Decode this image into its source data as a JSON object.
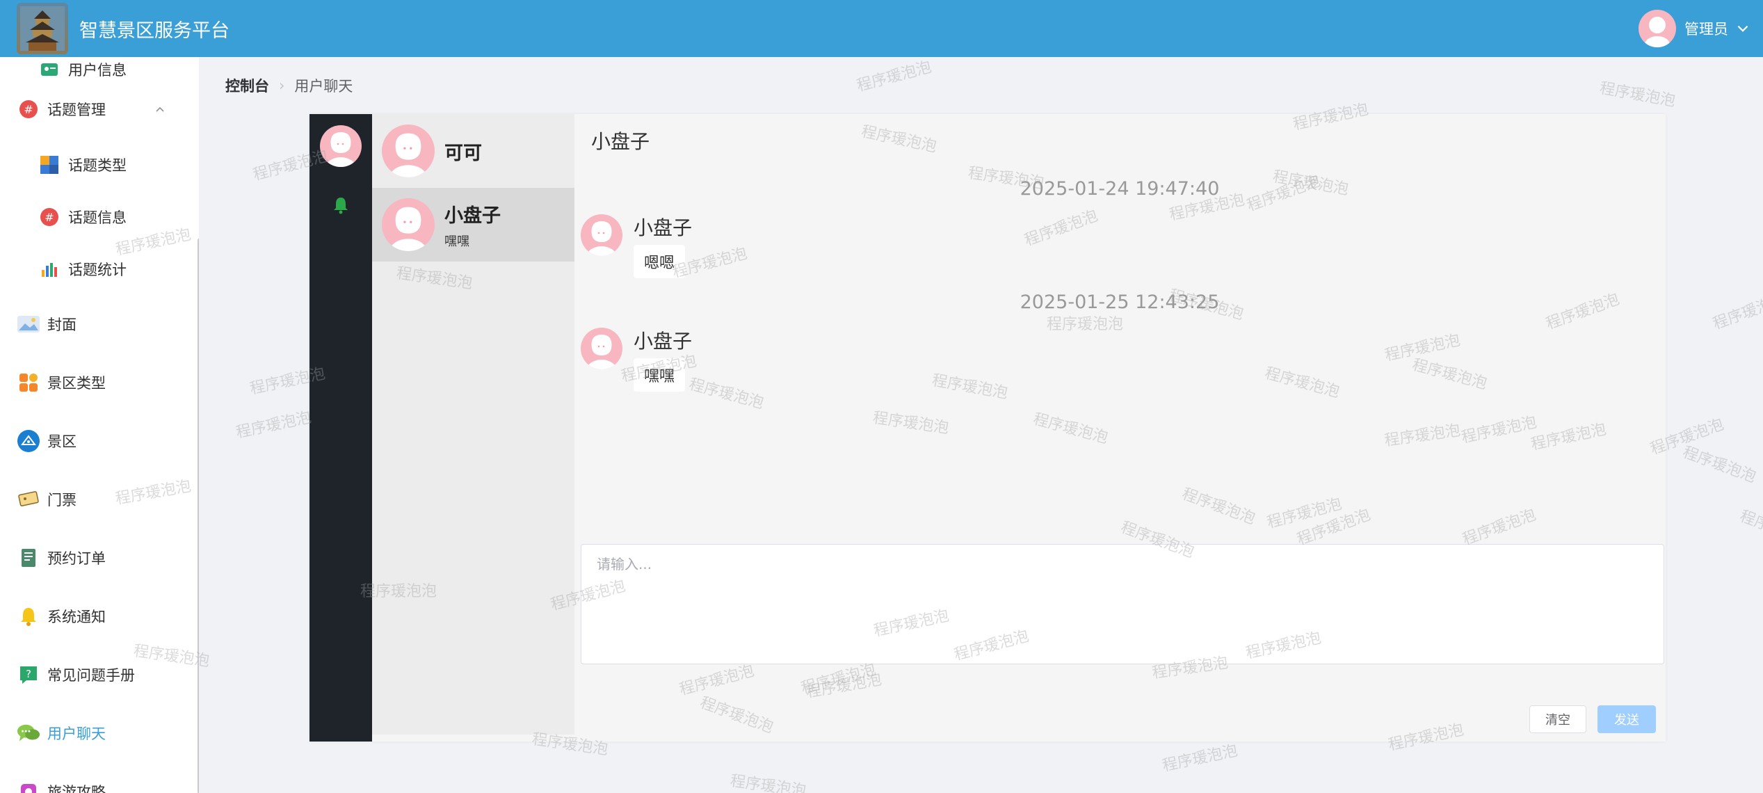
{
  "header": {
    "title": "智慧景区服务平台",
    "user_name": "管理员"
  },
  "sidebar": {
    "items": [
      {
        "label": "用户信息",
        "icon": "user-card-icon"
      },
      {
        "label": "话题管理",
        "icon": "hash-icon"
      },
      {
        "label": "话题类型",
        "icon": "topic-type-icon"
      },
      {
        "label": "话题信息",
        "icon": "hash-icon"
      },
      {
        "label": "话题统计",
        "icon": "bar-chart-icon"
      },
      {
        "label": "封面",
        "icon": "image-icon"
      },
      {
        "label": "景区类型",
        "icon": "grid-icon"
      },
      {
        "label": "景区",
        "icon": "compass-icon"
      },
      {
        "label": "门票",
        "icon": "ticket-icon"
      },
      {
        "label": "预约订单",
        "icon": "notebook-icon"
      },
      {
        "label": "系统通知",
        "icon": "bell-icon"
      },
      {
        "label": "常见问题手册",
        "icon": "question-icon"
      },
      {
        "label": "用户聊天",
        "icon": "chat-icon"
      },
      {
        "label": "旅游攻略",
        "icon": "guide-icon"
      }
    ],
    "accent_color": "#3a9fd6"
  },
  "breadcrumb": {
    "home": "控制台",
    "current": "用户聊天"
  },
  "chat": {
    "conversations": [
      {
        "name": "可可",
        "last_message": ""
      },
      {
        "name": "小盘子",
        "last_message": "嘿嘿"
      }
    ],
    "active_title": "小盘子",
    "messages": [
      {
        "time": "2025-01-24 19:47:40",
        "sender": "小盘子",
        "text": "嗯嗯"
      },
      {
        "time": "2025-01-25 12:43:25",
        "sender": "小盘子",
        "text": "嘿嘿"
      }
    ],
    "input_placeholder": "请输入...",
    "clear_label": "清空",
    "send_label": "发送"
  },
  "watermark": "程序瑗泡泡"
}
